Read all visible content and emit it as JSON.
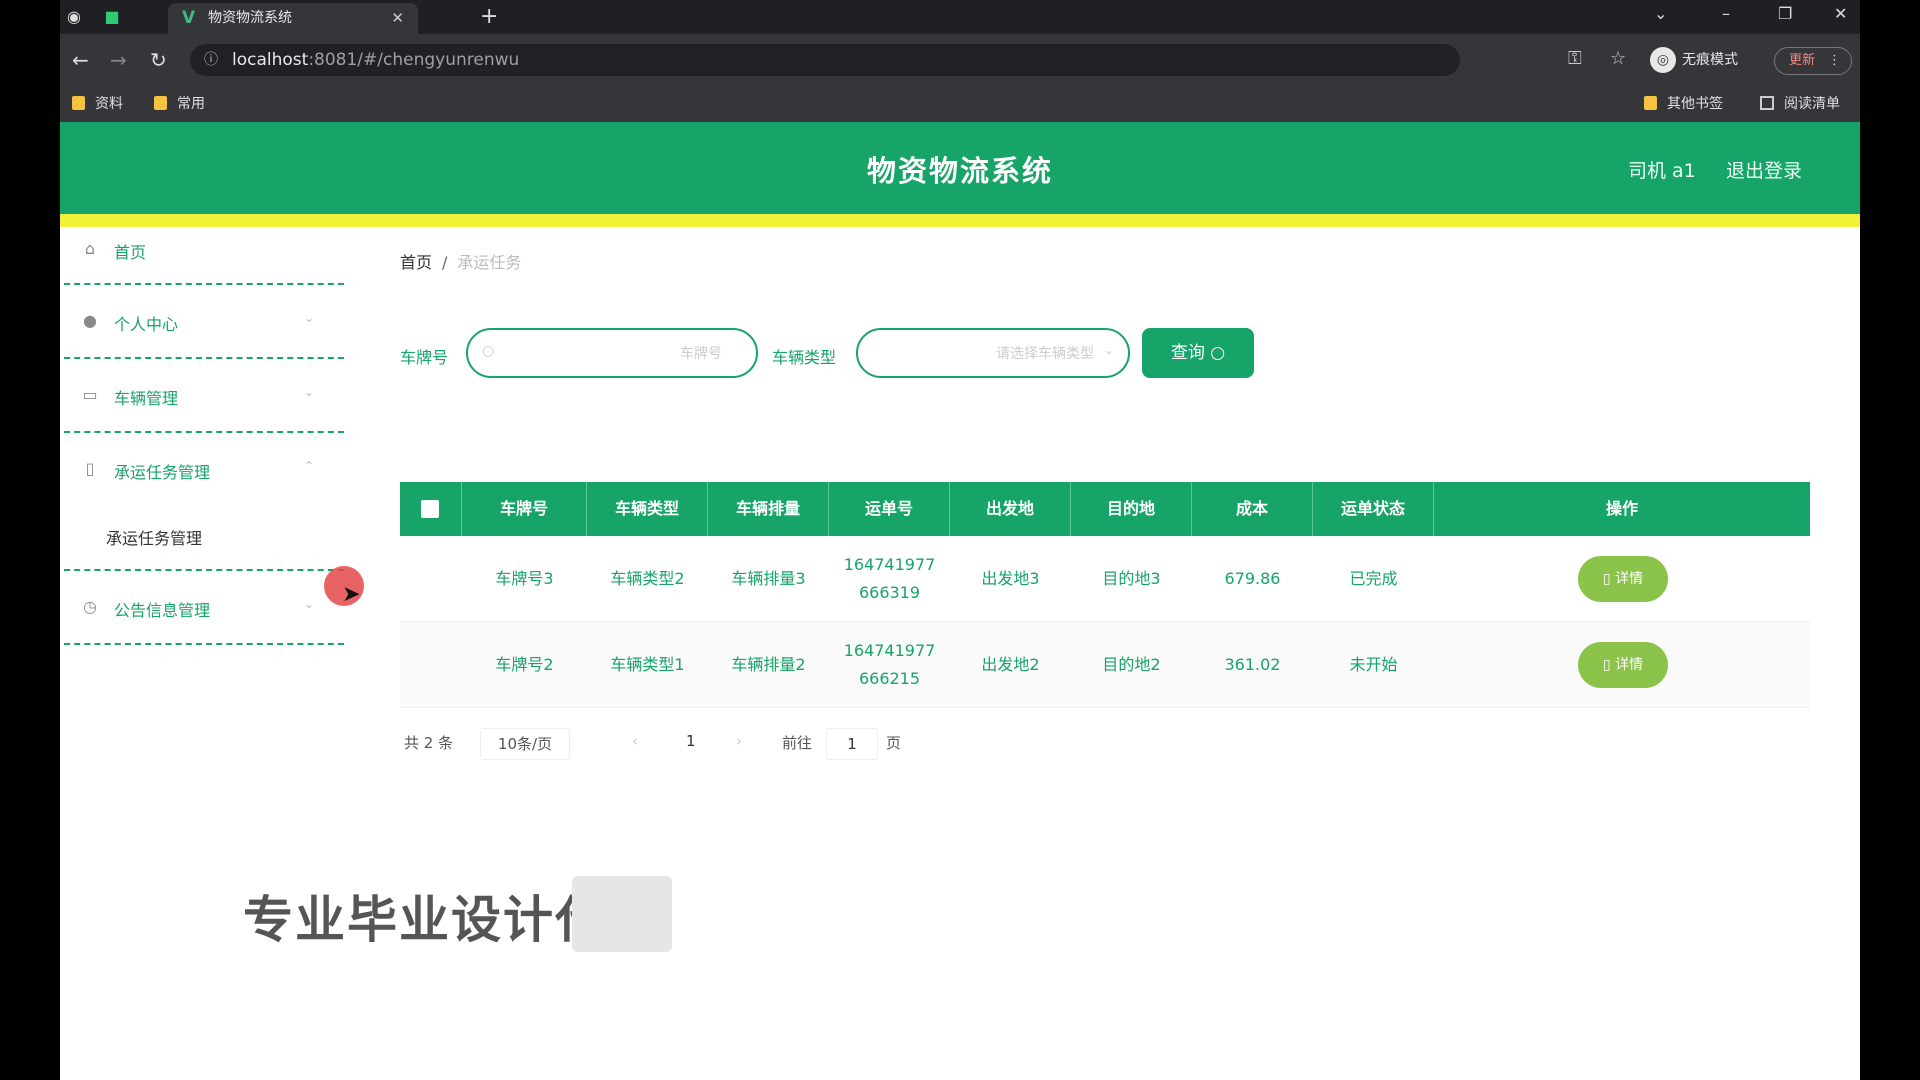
{
  "browser": {
    "tab_title": "物资物流系统",
    "tab_logo": "V",
    "url_host": "localhost",
    "url_path": ":8081/#/chengyunrenwu",
    "incognito_label": "无痕模式",
    "update_label": "更新",
    "bookmarks": [
      "资料",
      "常用"
    ],
    "bookmarks_right": [
      "其他书签",
      "阅读清单"
    ]
  },
  "header": {
    "title": "物资物流系统",
    "user": "司机 a1",
    "logout": "退出登录"
  },
  "sidebar": {
    "items": [
      {
        "label": "首页",
        "icon": "home-icon"
      },
      {
        "label": "个人中心",
        "icon": "user-icon"
      },
      {
        "label": "车辆管理",
        "icon": "vehicle-icon"
      },
      {
        "label": "承运任务管理",
        "icon": "task-icon"
      },
      {
        "label": "公告信息管理",
        "icon": "notice-icon"
      }
    ],
    "sub_item": "承运任务管理"
  },
  "breadcrumb": {
    "home": "首页",
    "separator": "/",
    "current": "承运任务"
  },
  "search": {
    "plate_label": "车牌号",
    "plate_placeholder": "车牌号",
    "type_label": "车辆类型",
    "type_placeholder": "请选择车辆类型",
    "query_label": "查询"
  },
  "table": {
    "columns": [
      "车牌号",
      "车辆类型",
      "车辆排量",
      "运单号",
      "出发地",
      "目的地",
      "成本",
      "运单状态",
      "操作"
    ],
    "rows": [
      {
        "plate": "车牌号3",
        "type": "车辆类型2",
        "displacement": "车辆排量3",
        "waybill_a": "164741977",
        "waybill_b": "666319",
        "origin": "出发地3",
        "destination": "目的地3",
        "cost": "679.86",
        "status": "已完成",
        "action": "详情"
      },
      {
        "plate": "车牌号2",
        "type": "车辆类型1",
        "displacement": "车辆排量2",
        "waybill_a": "164741977",
        "waybill_b": "666215",
        "origin": "出发地2",
        "destination": "目的地2",
        "cost": "361.02",
        "status": "未开始",
        "action": "详情"
      }
    ]
  },
  "pagination": {
    "total": "共 2 条",
    "page_size": "10条/页",
    "current_page": "1",
    "goto_label": "前往",
    "goto_value": "1",
    "page_unit": "页"
  },
  "watermark": "专业毕业设计代",
  "colors": {
    "primary": "#17a468",
    "accent_strip": "#eef23a",
    "action_button": "#8bc34a"
  }
}
